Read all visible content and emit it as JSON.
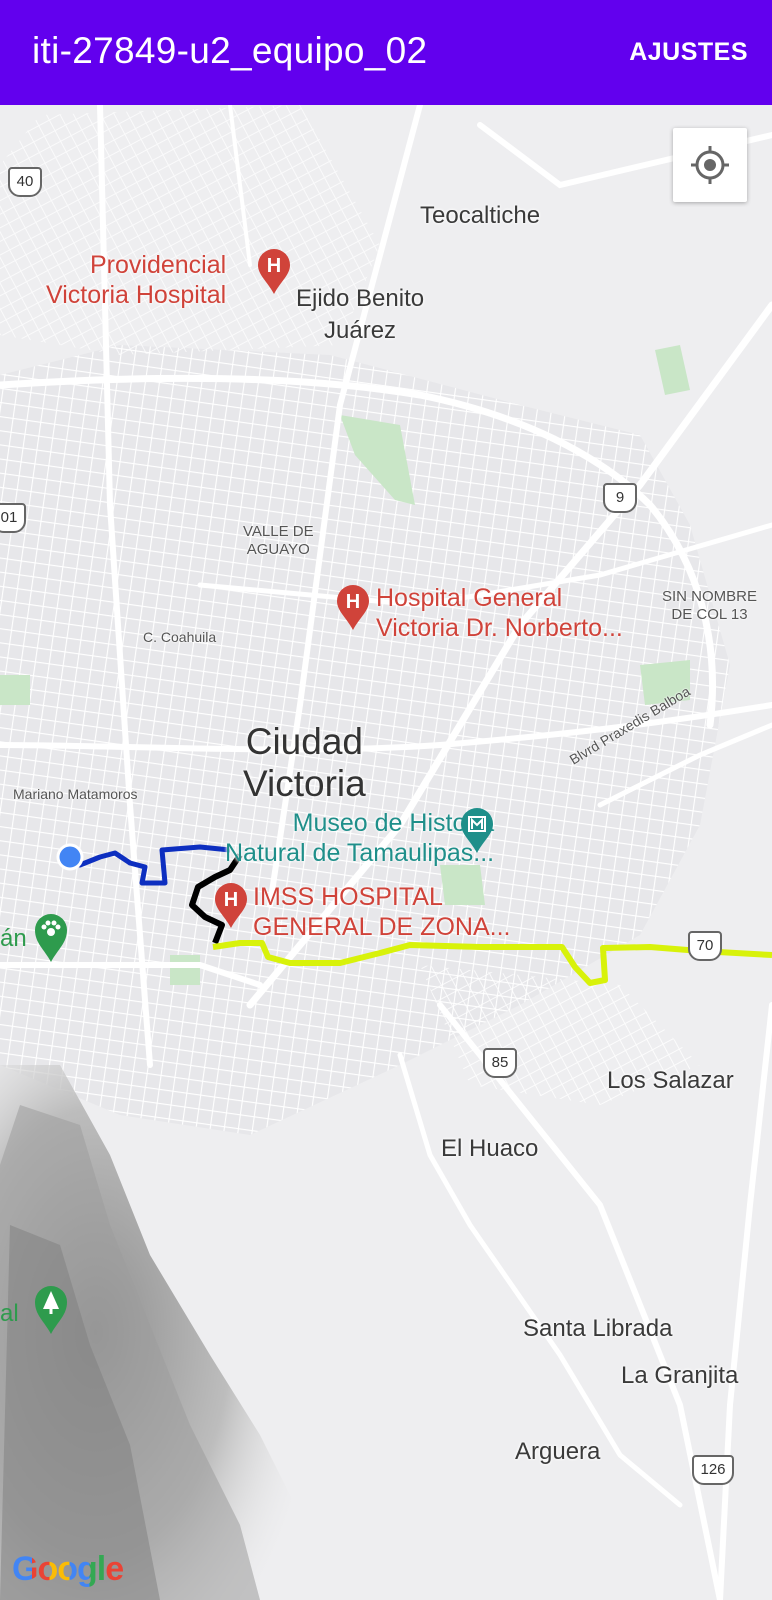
{
  "appbar": {
    "title": "iti-27849-u2_equipo_02",
    "action": "AJUSTES"
  },
  "map": {
    "places": {
      "teocaltiche": "Teocaltiche",
      "ejido": "Ejido Benito\nJuárez",
      "valle": "VALLE DE\nAGUAYO",
      "sin_nombre": "SIN NOMBRE\nDE COL 13",
      "coahuila": "C. Coahuila",
      "mariano": "Mariano Matamoros",
      "praxedis": "Blvrd Praxedis Balboa",
      "los_salazar": "Los Salazar",
      "el_huaco": "El Huaco",
      "santa_librada": "Santa Librada",
      "la_granjita": "La Granjita",
      "arguera": "Arguera",
      "city": "Ciudad\nVictoria",
      "left_an": "án",
      "left_al": "al"
    },
    "pois": {
      "providencial": "Providencial\nVictoria Hospital",
      "hospital_general": "Hospital General\nVictoria Dr. Norberto...",
      "museo": "Museo de Historia\nNatural de Tamaulipas...",
      "imss": "IMSS HOSPITAL\nGENERAL DE ZONA..."
    },
    "shields": {
      "r40": "40",
      "r101": "01",
      "r9": "9",
      "r70": "70",
      "r85": "85",
      "r126": "126"
    },
    "attribution": "Google",
    "colors": {
      "appbar": "#6200ee",
      "route_blue": "#0d2fc0",
      "route_black": "#000000",
      "route_lime": "#d8f20a",
      "hospital": "#d0433a",
      "museum": "#1f8f8a"
    }
  }
}
